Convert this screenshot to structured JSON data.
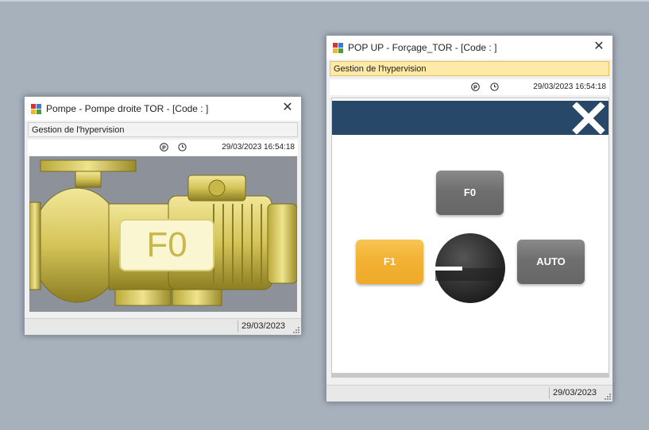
{
  "pump_window": {
    "title": "Pompe - Pompe droite TOR - [Code : ]",
    "close_glyph": "✕",
    "menu_label": "Gestion de l'hypervision",
    "datetime": "29/03/2023 16:54:18",
    "pump_state_label": "F0",
    "status_date": "29/03/2023",
    "icons": [
      "app-icon",
      "p-circle-icon",
      "clock-icon",
      "pump-image"
    ]
  },
  "popup_window": {
    "title": "POP UP - Forçage_TOR - [Code : ]",
    "close_glyph": "✕",
    "menu_label": "Gestion de l'hypervision",
    "datetime": "29/03/2023 16:54:18",
    "buttons": {
      "f0": "F0",
      "f1": "F1",
      "auto": "AUTO"
    },
    "selected_mode": "F1",
    "status_date": "29/03/2023",
    "colors": {
      "header": "#274868",
      "menu_highlight": "#fde9a8",
      "f1_active": "#f2b234",
      "button_inactive": "#6f6f6f"
    }
  }
}
